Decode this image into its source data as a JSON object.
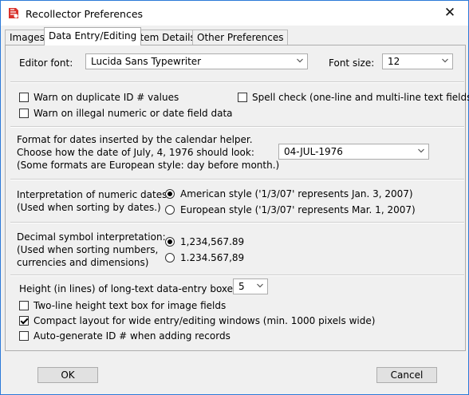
{
  "window": {
    "title": "Recollector Preferences",
    "close_glyph": "✕"
  },
  "tabs": [
    "Images",
    "Data Entry/Editing",
    "Item Details",
    "Other Preferences"
  ],
  "active_tab": "Data Entry/Editing",
  "editor": {
    "font_label": "Editor font:",
    "font_value": "Lucida Sans Typewriter",
    "size_label": "Font size:",
    "size_value": "12"
  },
  "warnings": {
    "duplicate_id": {
      "label": "Warn on duplicate ID # values",
      "checked": false
    },
    "spell_check": {
      "label": "Spell check (one-line and multi-line text fields)",
      "checked": false
    },
    "illegal_data": {
      "label": "Warn on illegal numeric or date field data",
      "checked": false
    }
  },
  "date_format": {
    "line1": "Format for dates inserted by the calendar helper.",
    "line2": "Choose how the date of July, 4, 1976 should look:",
    "line3": "(Some formats are European style: day before month.)",
    "value": "04-JUL-1976"
  },
  "numeric_dates": {
    "line1": "Interpretation of numeric dates:",
    "line2": "(Used when sorting by dates.)",
    "option_american": "American style ('1/3/07' represents Jan. 3, 2007)",
    "option_european": "European style ('1/3/07' represents Mar. 1, 2007)",
    "selected": "american"
  },
  "decimal": {
    "line1": "Decimal symbol interpretation:",
    "line2": "(Used when sorting numbers,",
    "line3": "currencies and dimensions)",
    "option_point": "1,234,567.89",
    "option_comma": "1.234.567,89",
    "selected": "point"
  },
  "long_text": {
    "height_label": "Height (in lines) of long-text data-entry boxes:",
    "height_value": "5",
    "two_line": {
      "label": "Two-line height text box for image fields",
      "checked": false
    },
    "compact": {
      "label": "Compact layout for wide entry/editing windows (min. 1000 pixels wide)",
      "checked": true
    },
    "auto_id": {
      "label": "Auto-generate ID # when adding records",
      "checked": false
    }
  },
  "buttons": {
    "ok": "OK",
    "cancel": "Cancel"
  },
  "colors": {
    "window_border": "#2b79d8",
    "icon_red": "#d9312b",
    "dialog_bg": "#f0f0f0"
  },
  "icons": {
    "app": "recollector-app-icon",
    "dropdown": "chevron-down-icon",
    "close": "close-icon"
  }
}
